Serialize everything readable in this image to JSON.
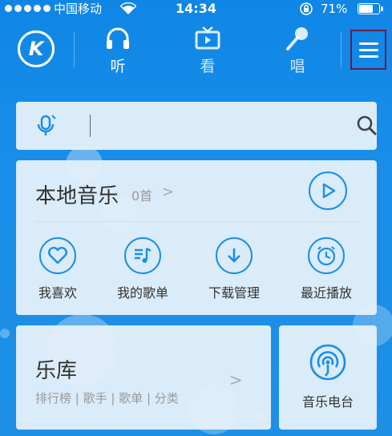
{
  "status_bar": {
    "carrier": "中国移动",
    "time": "14:34",
    "battery_percent": "71%",
    "battery_level": 0.71
  },
  "nav": {
    "logo_letter": "K",
    "tabs": [
      {
        "label": "听",
        "icon": "headphones-icon",
        "active": true
      },
      {
        "label": "看",
        "icon": "tv-icon",
        "active": false
      },
      {
        "label": "唱",
        "icon": "microphone-icon",
        "active": false
      }
    ],
    "menu_icon": "menu-icon"
  },
  "search": {
    "placeholder": "",
    "value": "",
    "mic_icon": "voice-search-icon",
    "search_icon": "search-icon"
  },
  "local_music": {
    "title": "本地音乐",
    "count": "0首",
    "chevron": ">",
    "play_icon": "play-icon",
    "actions": [
      {
        "label": "我喜欢",
        "icon": "heart-icon"
      },
      {
        "label": "我的歌单",
        "icon": "playlist-icon"
      },
      {
        "label": "下载管理",
        "icon": "download-icon"
      },
      {
        "label": "最近播放",
        "icon": "clock-icon"
      }
    ]
  },
  "library": {
    "title": "乐库",
    "subtitle": "排行榜 | 歌手 | 歌单 | 分类",
    "chevron": ">"
  },
  "radio": {
    "label": "音乐电台",
    "icon": "radio-icon"
  },
  "colors": {
    "accent": "#1a8ee8",
    "background": "#1d8fe5",
    "card": "#e5f0fa"
  }
}
